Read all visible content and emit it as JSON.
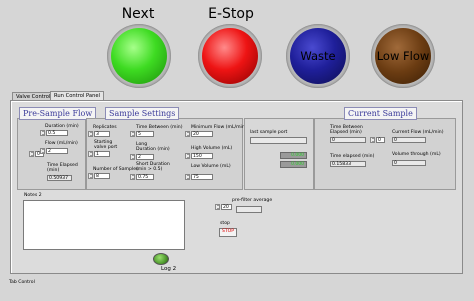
{
  "indicators": {
    "next": {
      "label": "Next",
      "color": "#3edb22"
    },
    "estop": {
      "label": "E-Stop",
      "color": "#ee1414"
    },
    "waste": {
      "label": "Waste",
      "color": "#1f1f9a"
    },
    "lowflow": {
      "label": "Low Flow",
      "color": "#6b3c12"
    }
  },
  "tabs": [
    {
      "label": "Valve Controls"
    },
    {
      "label": "Run Control Panel"
    }
  ],
  "pre_sample": {
    "title": "Pre-Sample Flow",
    "stepper_value": "0",
    "duration_label": "Duration (min)",
    "duration_value": "0.5",
    "flow_label": "Flow (mL/min)",
    "flow_value": "2",
    "time_elapsed_label": "Time Elapsed\n(min)",
    "time_elapsed_value": "0.50937"
  },
  "sample_settings": {
    "title": "Sample Settings",
    "replicates_label": "Replicates",
    "replicates_value": "3",
    "starting_valve_label": "Starting\nvalve port",
    "starting_valve_value": "1",
    "num_samples_label": "Number of Samples",
    "num_samples_value": "8",
    "time_between_label": "Time Between (min)",
    "time_between_value": "5",
    "long_duration_label": "Long\nDuration (min)",
    "long_duration_value": "2",
    "short_duration_label": "Short Duration\n(min > 0.5)",
    "short_duration_value": "0.75",
    "min_flow_label": "Minimum Flow (mL/min)",
    "min_flow_value": "20",
    "high_volume_label": "High Volume (mL)",
    "high_volume_value": "150",
    "low_volume_label": "Low Volume (mL)",
    "low_volume_value": "75"
  },
  "sample_port": {
    "last_port_label": "last sample port",
    "last_port_value": "",
    "reading_1": "0.000",
    "reading_2": "0.000"
  },
  "current_sample": {
    "title": "Current Sample",
    "time_between_label": "Time Between\nElapsed (min)",
    "time_between_value": "0",
    "time_elapsed_label": "Time elapsed (min)",
    "time_elapsed_value": "0.15833",
    "stepper_value": "0",
    "current_flow_label": "Current Flow (mL/min)",
    "current_flow_value": "0",
    "volume_through_label": "Volume through (mL)",
    "volume_through_value": "0"
  },
  "notes": {
    "label": "Notes 2",
    "value": ""
  },
  "prefilter": {
    "stepper_value": "20",
    "label": "pre-filter average",
    "value": ""
  },
  "stop": {
    "label": "stop",
    "button_label": "STOP"
  },
  "log": {
    "label": "Log 2"
  },
  "footer": {
    "label": "Tab Control"
  }
}
